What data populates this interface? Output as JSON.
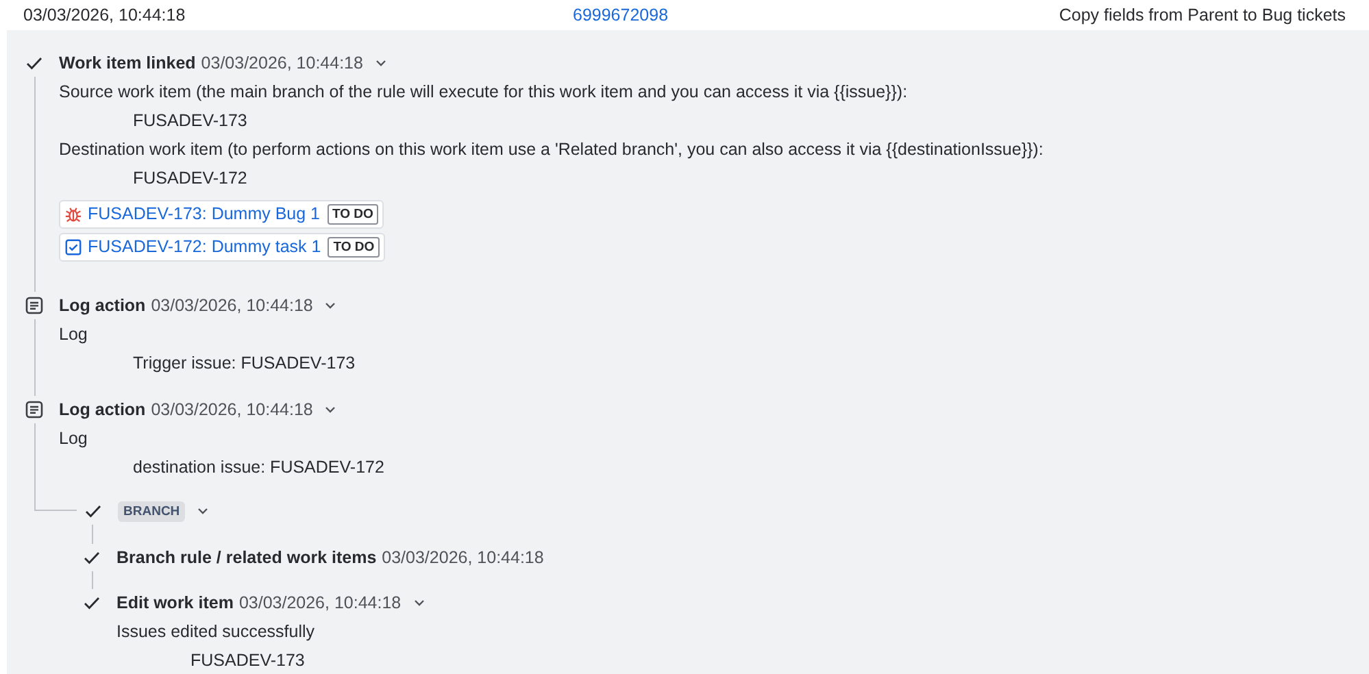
{
  "header": {
    "time": "03/03/2026, 10:44:18",
    "id": "6999672098",
    "rule": "Copy fields from Parent to Bug tickets"
  },
  "entries": [
    {
      "kind": "success",
      "title": "Work item linked",
      "time": "03/03/2026, 10:44:18",
      "expandable": true,
      "details": [
        {
          "kind": "text",
          "text": "Source work item (the main branch of the rule will execute for this work item and you can access it via {{issue}}):"
        },
        {
          "kind": "value",
          "text": "FUSADEV-173"
        },
        {
          "kind": "text",
          "text": "Destination work item (to perform actions on this work item use a 'Related branch', you can also access it via {{destinationIssue}}):"
        },
        {
          "kind": "value",
          "text": "FUSADEV-172"
        },
        {
          "kind": "bug",
          "text": "FUSADEV-173: Dummy Bug 1",
          "status": "TO DO"
        },
        {
          "kind": "task",
          "text": "FUSADEV-172: Dummy task 1",
          "status": "TO DO"
        }
      ]
    },
    {
      "kind": "log",
      "title": "Log action",
      "time": "03/03/2026, 10:44:18",
      "expandable": true,
      "details": [
        {
          "kind": "text",
          "text": "Log"
        },
        {
          "kind": "value",
          "text": "Trigger issue: FUSADEV-173"
        }
      ]
    },
    {
      "kind": "log",
      "title": "Log action",
      "time": "03/03/2026, 10:44:18",
      "expandable": true,
      "details": [
        {
          "kind": "text",
          "text": "Log"
        },
        {
          "kind": "value",
          "text": "destination issue: FUSADEV-172"
        }
      ]
    }
  ],
  "branch": {
    "label": "BRANCH",
    "expandable": true,
    "entries": [
      {
        "kind": "success",
        "title": "Branch rule / related work items",
        "time": "03/03/2026, 10:44:18",
        "expandable": false
      },
      {
        "kind": "success",
        "title": "Edit work item",
        "time": "03/03/2026, 10:44:18",
        "expandable": true,
        "details": [
          {
            "kind": "text",
            "text": "Issues edited successfully"
          },
          {
            "kind": "value",
            "text": "FUSADEV-173"
          }
        ]
      }
    ]
  }
}
